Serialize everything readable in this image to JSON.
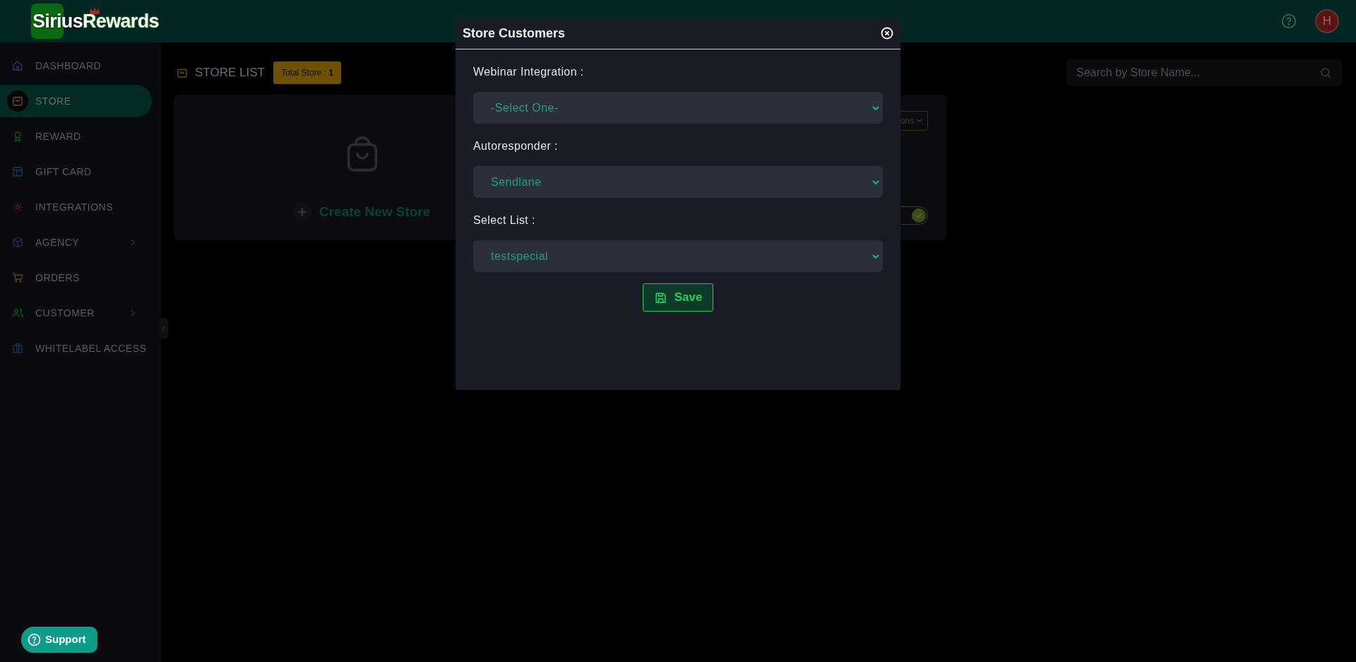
{
  "header": {
    "logo_left": "Sirius",
    "logo_right": "Rewards",
    "avatar": "H"
  },
  "sidebar": {
    "items": [
      {
        "label": "DASHBOARD",
        "selected": false,
        "has_submenu": false
      },
      {
        "label": "STORE",
        "selected": true,
        "has_submenu": false
      },
      {
        "label": "REWARD",
        "selected": false,
        "has_submenu": false
      },
      {
        "label": "GIFT CARD",
        "selected": false,
        "has_submenu": false
      },
      {
        "label": "INTEGRATIONS",
        "selected": false,
        "has_submenu": false
      },
      {
        "label": "AGENCY",
        "selected": false,
        "has_submenu": true
      },
      {
        "label": "ORDERS",
        "selected": false,
        "has_submenu": false
      },
      {
        "label": "CUSTOMER",
        "selected": false,
        "has_submenu": true
      },
      {
        "label": "WHITELABEL ACCESS",
        "selected": false,
        "has_submenu": false
      }
    ]
  },
  "page": {
    "title": "STORE LIST",
    "badge": "Total Store : **1**",
    "search": {
      "placeholder": "Search by Store Name..."
    },
    "card": {
      "create_label": "Create New Store",
      "options_label": "ons",
      "toggle_on": true
    }
  },
  "support_button": "Support",
  "modal": {
    "title": "Store Customers",
    "fields": [
      {
        "label": "Webinar Integration :",
        "value": "-Select One-"
      },
      {
        "label": "Autoresponder :",
        "value": "Sendlane"
      },
      {
        "label": "Select List :",
        "value": "testspecial"
      }
    ],
    "save_button": "Save"
  }
}
